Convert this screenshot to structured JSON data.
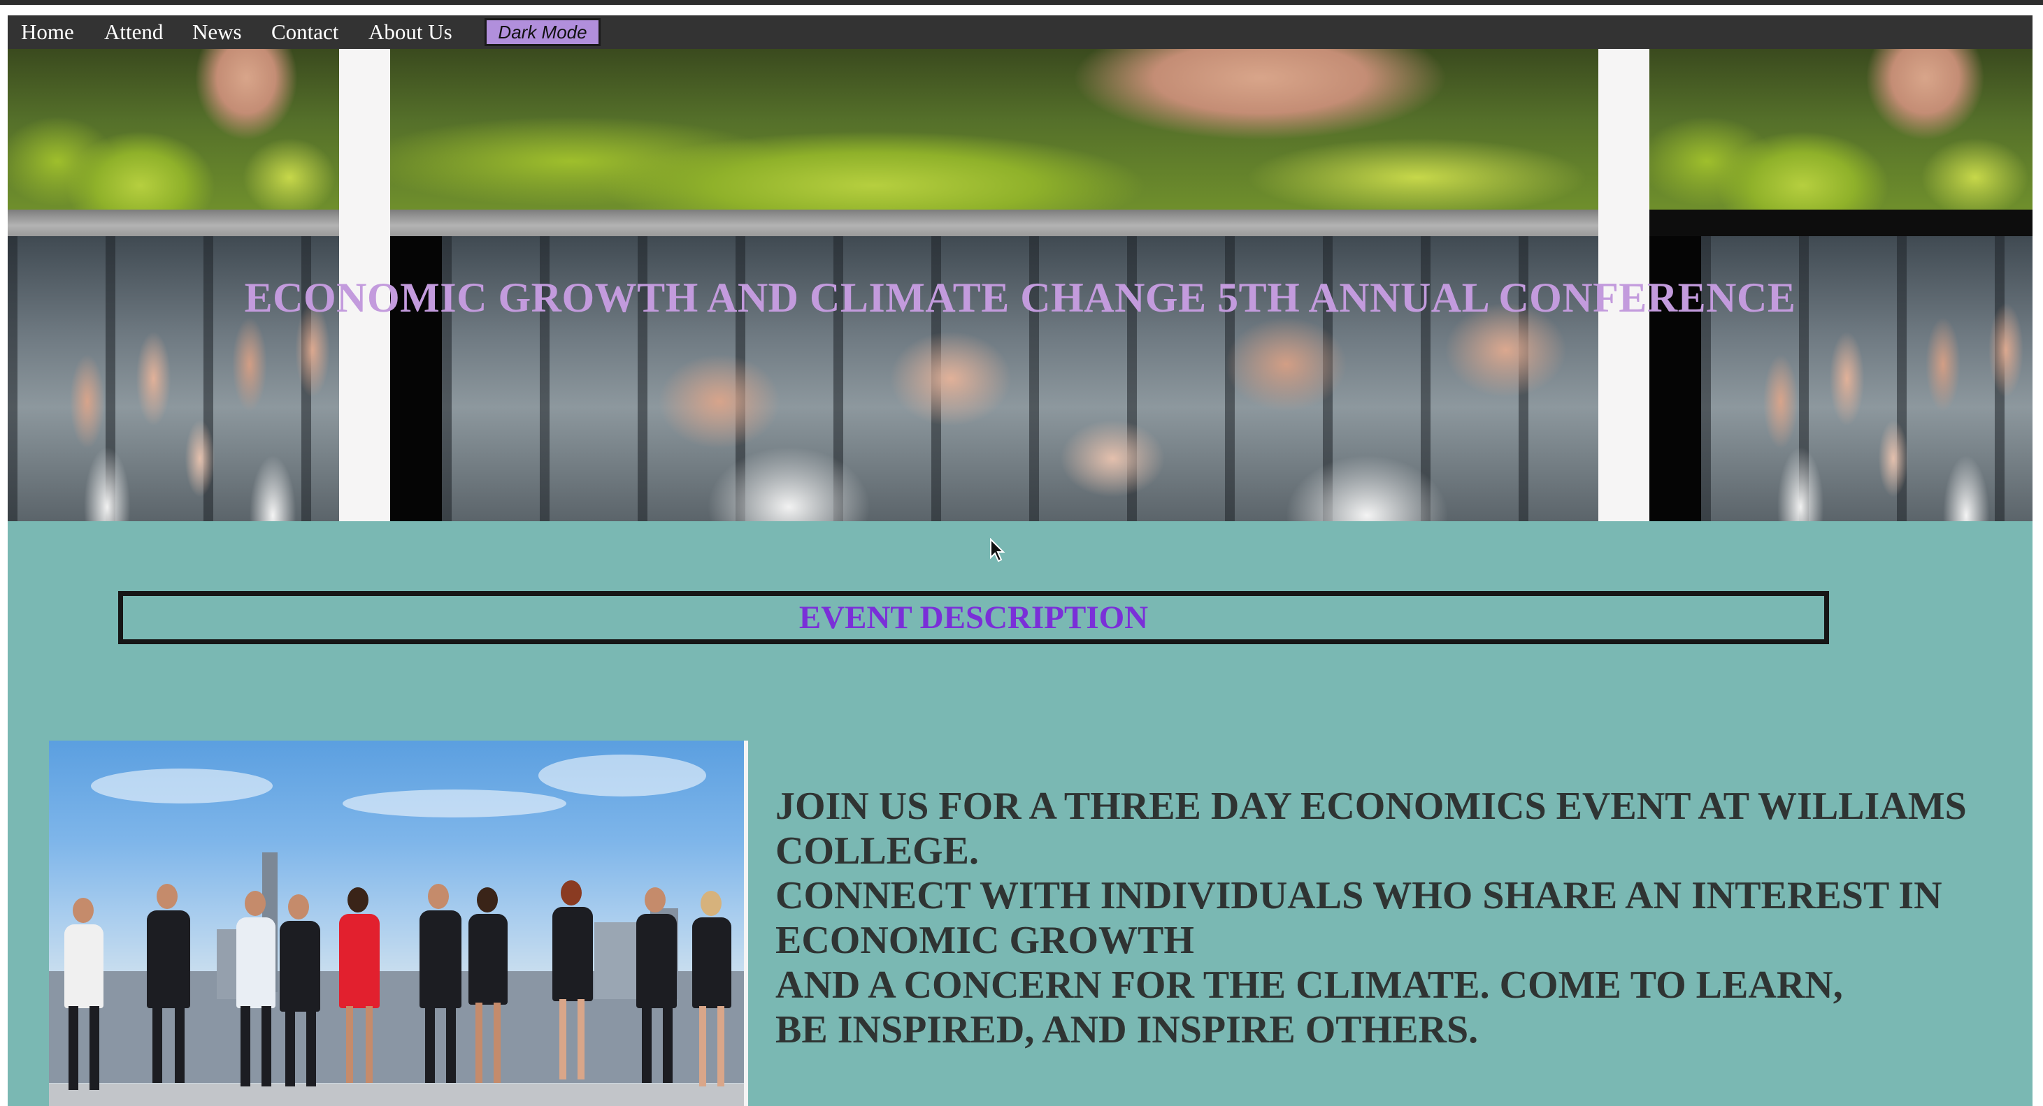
{
  "nav": {
    "items": [
      "Home",
      "Attend",
      "News",
      "Contact",
      "About Us"
    ],
    "dark_mode_label": "Dark Mode"
  },
  "hero": {
    "title": "ECONOMIC GROWTH AND CLIMATE CHANGE 5TH ANNUAL CONFERENCE"
  },
  "event": {
    "heading": "EVENT DESCRIPTION",
    "lines": [
      "JOIN US FOR A THREE DAY ECONOMICS EVENT AT WILLIAMS COLLEGE.",
      "CONNECT WITH INDIVIDUALS WHO SHARE AN INTEREST IN ECONOMIC GROWTH",
      "AND A CONCERN FOR THE CLIMATE. COME TO LEARN,",
      "BE INSPIRED, AND INSPIRE OTHERS."
    ]
  },
  "colors": {
    "page_background": "#7ab8b3",
    "nav_background": "#333333",
    "dark_mode_button": "#b18fdc",
    "hero_title": "#c39bdd",
    "event_heading": "#7a2fd8",
    "body_text": "#2f3433"
  },
  "icons": {
    "cursor": "pointer-cursor-icon"
  }
}
